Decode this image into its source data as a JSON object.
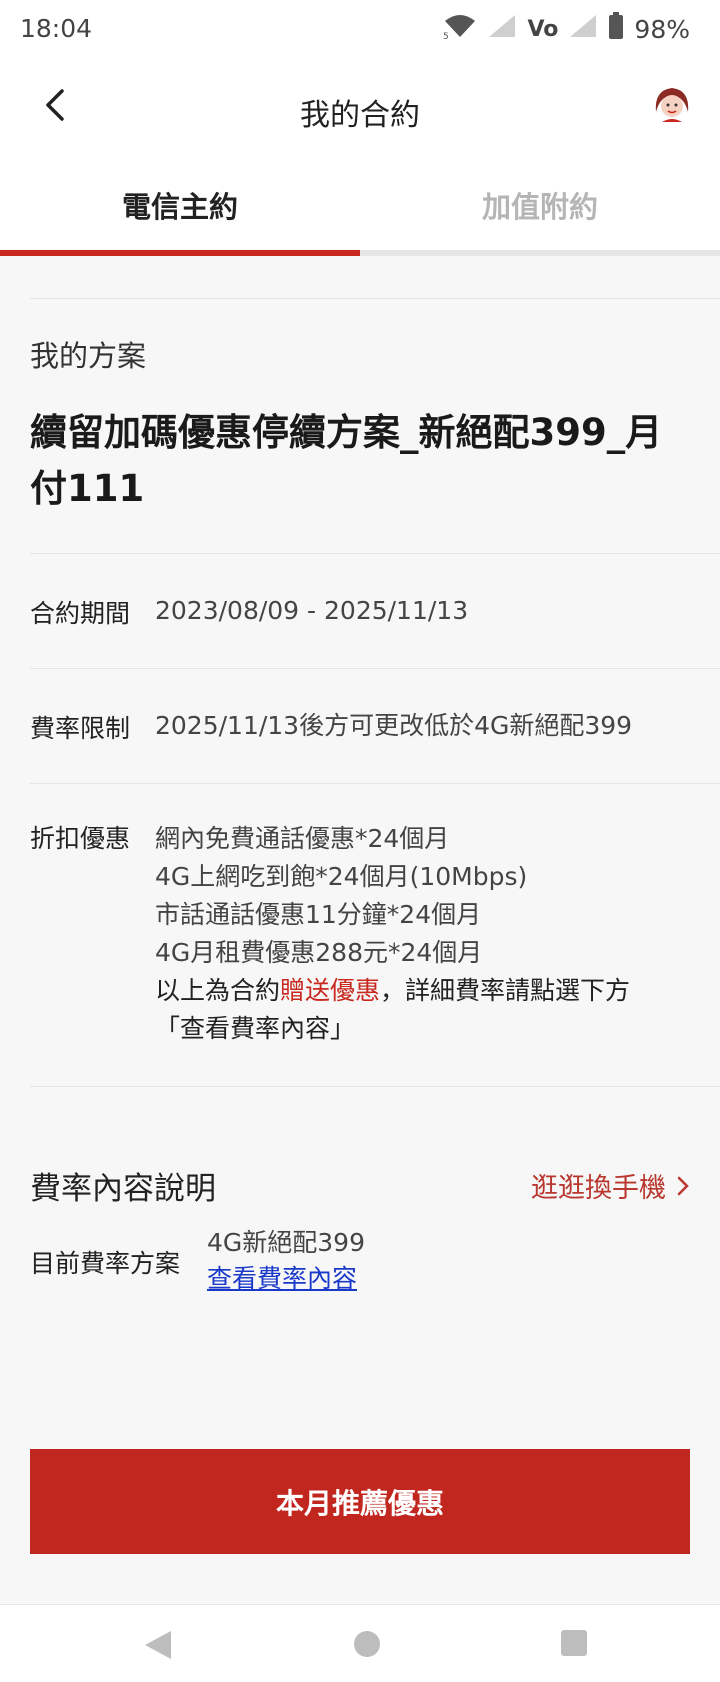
{
  "status_bar": {
    "time": "18:04",
    "battery": "98%",
    "volte": "Vo",
    "wifi_icon": "wifi-icon",
    "signal_icon": "signal-icon",
    "battery_icon": "battery-icon"
  },
  "header": {
    "title": "我的合約",
    "back_icon": "back-arrow-icon",
    "avatar_icon": "avatar-icon"
  },
  "tabs": [
    {
      "label": "電信主約",
      "active": true
    },
    {
      "label": "加值附約",
      "active": false
    }
  ],
  "plan": {
    "section_label": "我的方案",
    "name_line1": "續留加碼優惠停續方案_新絕配399_月",
    "name_line2": "付111"
  },
  "details": {
    "period_label": "合約期間",
    "period_value": "2023/08/09 - 2025/11/13",
    "rate_limit_label": "費率限制",
    "rate_limit_value": "2025/11/13後方可更改低於4G新絕配399",
    "discount_label": "折扣優惠",
    "discounts": [
      "網內免費通話優惠*24個月",
      "4G上網吃到飽*24個月(10Mbps)",
      "市話通話優惠11分鐘*24個月",
      "4G月租費優惠288元*24個月"
    ],
    "note_prefix": "以上為合約",
    "note_highlight": "贈送優惠",
    "note_suffix": "，詳細費率請點選下方",
    "note_line2": "「查看費率內容」"
  },
  "rate_section": {
    "title": "費率內容說明",
    "shop_link": "逛逛換手機",
    "current_label": "目前費率方案",
    "current_value": "4G新絕配399",
    "view_link": "查看費率內容"
  },
  "cta": {
    "label": "本月推薦優惠"
  },
  "colors": {
    "accent": "#c8281e",
    "link": "#1a39c8",
    "background": "#f7f7f8"
  }
}
